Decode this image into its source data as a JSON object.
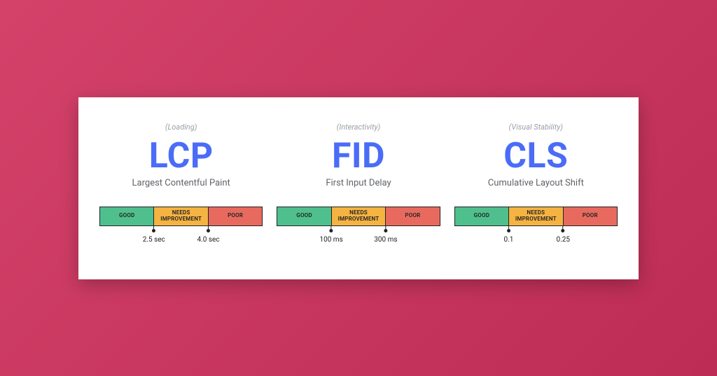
{
  "metrics": [
    {
      "category": "(Loading)",
      "abbr": "LCP",
      "fullname": "Largest Contentful Paint",
      "segments": {
        "good": "GOOD",
        "needs": "NEEDS IMPROVEMENT",
        "poor": "POOR"
      },
      "thresholds": {
        "t1": "2.5 sec",
        "t2": "4.0 sec"
      }
    },
    {
      "category": "(Interactivity)",
      "abbr": "FID",
      "fullname": "First Input Delay",
      "segments": {
        "good": "GOOD",
        "needs": "NEEDS IMPROVEMENT",
        "poor": "POOR"
      },
      "thresholds": {
        "t1": "100 ms",
        "t2": "300 ms"
      }
    },
    {
      "category": "(Visual Stability)",
      "abbr": "CLS",
      "fullname": "Cumulative Layout Shift",
      "segments": {
        "good": "GOOD",
        "needs": "NEEDS IMPROVEMENT",
        "poor": "POOR"
      },
      "thresholds": {
        "t1": "0.1",
        "t2": "0.25"
      }
    }
  ],
  "colors": {
    "background_gradient": [
      "#d4426a",
      "#bc2c54"
    ],
    "card": "#ffffff",
    "abbr": "#4a6cf7",
    "good": "#4fc08d",
    "needs": "#f5b342",
    "poor": "#e86a5e"
  }
}
